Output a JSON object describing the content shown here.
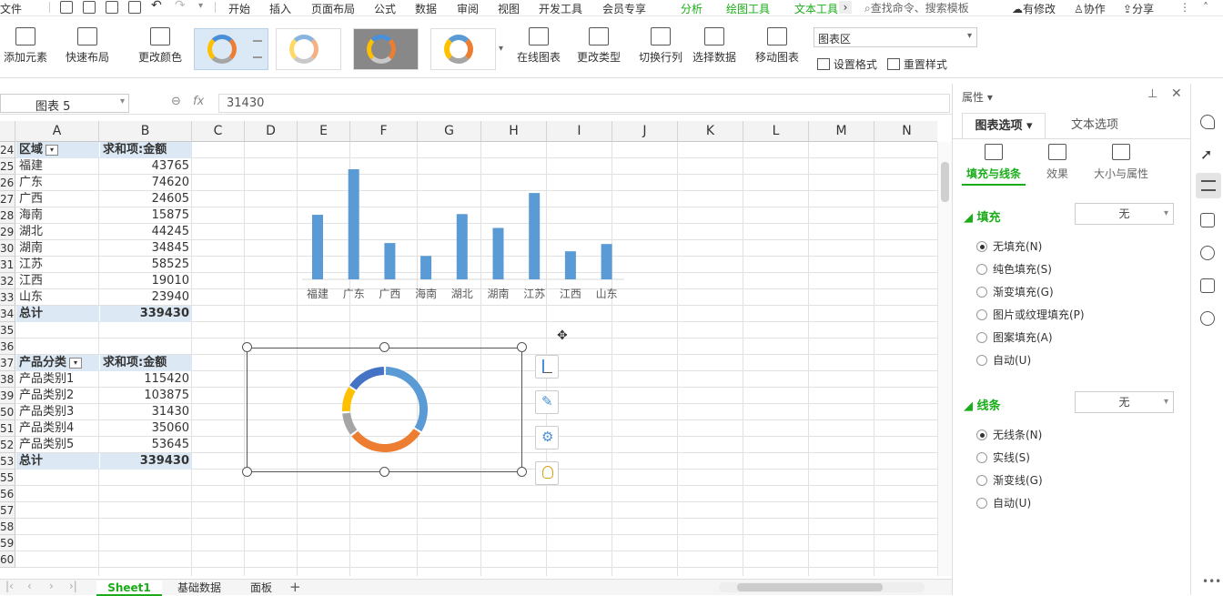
{
  "menu": {
    "file": "文件",
    "tabs": [
      "开始",
      "插入",
      "页面布局",
      "公式",
      "数据",
      "审阅",
      "视图",
      "开发工具",
      "会员专享"
    ],
    "context_tabs": [
      "分析",
      "绘图工具",
      "文本工具"
    ],
    "search": "查找命令、搜索模板",
    "modified": "有修改",
    "collab": "协作",
    "share": "分享"
  },
  "toolbar": {
    "add_element": "添加元素",
    "quick_layout": "快速布局",
    "change_color": "更改颜色",
    "online_chart": "在线图表",
    "change_type": "更改类型",
    "switch_rowcol": "切换行列",
    "select_data": "选择数据",
    "move_chart": "移动图表",
    "chart_area_select": "图表区",
    "set_format": "设置格式",
    "reset_style": "重置样式"
  },
  "formula_bar": {
    "name_box": "图表 5",
    "fx": "fx",
    "value": "31430"
  },
  "columns": [
    "A",
    "B",
    "C",
    "D",
    "E",
    "F",
    "G",
    "H",
    "I",
    "J",
    "K",
    "L",
    "M",
    "N"
  ],
  "rows": [
    "24",
    "25",
    "26",
    "27",
    "28",
    "29",
    "30",
    "31",
    "32",
    "33",
    "34",
    "35",
    "36",
    "37",
    "38",
    "39",
    "50",
    "51",
    "52",
    "53",
    "55",
    "56",
    "57",
    "58",
    "59",
    "60"
  ],
  "pivot_region": {
    "header_label": "区域",
    "header_value": "求和项:金额",
    "items": [
      {
        "name": "福建",
        "value": "43765"
      },
      {
        "name": "广东",
        "value": "74620"
      },
      {
        "name": "广西",
        "value": "24605"
      },
      {
        "name": "海南",
        "value": "15875"
      },
      {
        "name": "湖北",
        "value": "44245"
      },
      {
        "name": "湖南",
        "value": "34845"
      },
      {
        "name": "江苏",
        "value": "58525"
      },
      {
        "name": "江西",
        "value": "19010"
      },
      {
        "name": "山东",
        "value": "23940"
      }
    ],
    "total_label": "总计",
    "total_value": "339430"
  },
  "pivot_product": {
    "header_label": "产品分类",
    "header_value": "求和项:金额",
    "items": [
      {
        "name": "产品类别1",
        "value": "115420"
      },
      {
        "name": "产品类别2",
        "value": "103875"
      },
      {
        "name": "产品类别3",
        "value": "31430"
      },
      {
        "name": "产品类别4",
        "value": "35060"
      },
      {
        "name": "产品类别5",
        "value": "53645"
      }
    ],
    "total_label": "总计",
    "total_value": "339430"
  },
  "chart_data": [
    {
      "type": "bar",
      "categories": [
        "福建",
        "广东",
        "广西",
        "海南",
        "湖北",
        "湖南",
        "江苏",
        "江西",
        "山东"
      ],
      "values": [
        43765,
        74620,
        24605,
        15875,
        44245,
        34845,
        58525,
        19010,
        23940
      ],
      "title": "",
      "color": "#5b9bd5"
    },
    {
      "type": "pie",
      "style": "donut",
      "categories": [
        "产品类别1",
        "产品类别2",
        "产品类别3",
        "产品类别4",
        "产品类别5"
      ],
      "values": [
        115420,
        103875,
        31430,
        35060,
        53645
      ],
      "colors": [
        "#5b9bd5",
        "#ed7d31",
        "#a5a5a5",
        "#ffc000",
        "#4472c4"
      ]
    }
  ],
  "sheets": [
    "Sheet1",
    "基础数据",
    "面板"
  ],
  "panel": {
    "title": "属性",
    "tab_chart": "图表选项",
    "tab_text": "文本选项",
    "subtab_fill": "填充与线条",
    "subtab_effect": "效果",
    "subtab_size": "大小与属性",
    "fill_section": "填充",
    "fill_value": "无",
    "fill_options": [
      "无填充(N)",
      "纯色填充(S)",
      "渐变填充(G)",
      "图片或纹理填充(P)",
      "图案填充(A)",
      "自动(U)"
    ],
    "line_section": "线条",
    "line_value": "无",
    "line_options": [
      "无线条(N)",
      "实线(S)",
      "渐变线(G)",
      "自动(U)"
    ]
  }
}
